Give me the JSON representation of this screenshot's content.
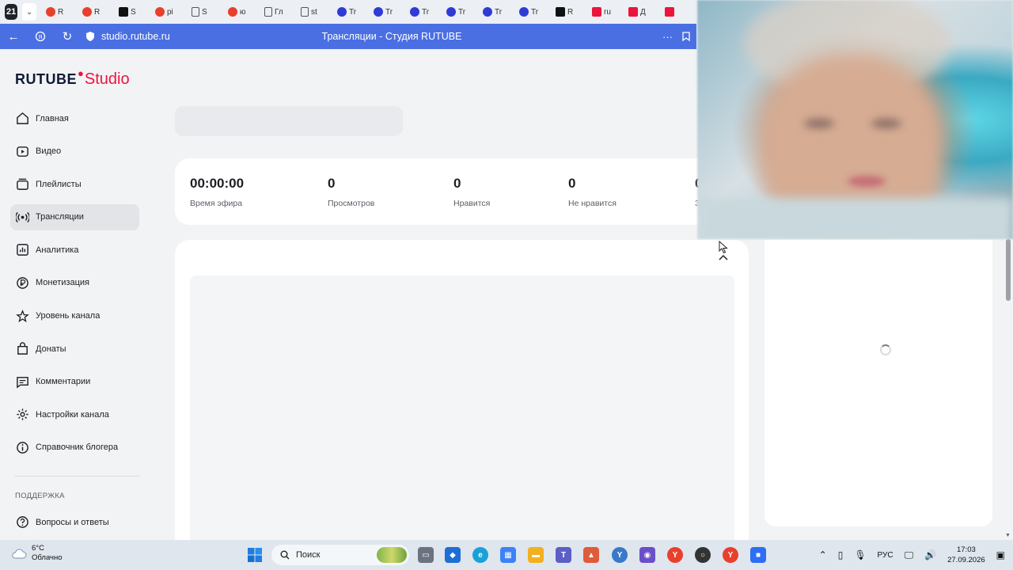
{
  "browser": {
    "tab_counter": "21",
    "tabs": [
      {
        "letter": "R",
        "color": "#e8402c",
        "kind": "yandex"
      },
      {
        "letter": "R",
        "color": "#e8402c",
        "kind": "mail"
      },
      {
        "letter": "S",
        "color": "#111111",
        "kind": "sq"
      },
      {
        "letter": "pi",
        "color": "#e8402c",
        "kind": "yandex"
      },
      {
        "letter": "S",
        "color": "#555555",
        "kind": "doc"
      },
      {
        "letter": "ю",
        "color": "#e8402c",
        "kind": "yandex"
      },
      {
        "letter": "Гл",
        "color": "#555555",
        "kind": "doc"
      },
      {
        "letter": "st",
        "color": "#555555",
        "kind": "doc"
      },
      {
        "letter": "Tr",
        "color": "#2f3bd6",
        "kind": "tw"
      },
      {
        "letter": "Tr",
        "color": "#2f3bd6",
        "kind": "tw"
      },
      {
        "letter": "Tr",
        "color": "#2f3bd6",
        "kind": "tw"
      },
      {
        "letter": "Tr",
        "color": "#2f3bd6",
        "kind": "tw"
      },
      {
        "letter": "Tr",
        "color": "#2f3bd6",
        "kind": "tw"
      },
      {
        "letter": "Tr",
        "color": "#2f3bd6",
        "kind": "tw"
      },
      {
        "letter": "R",
        "color": "#111111",
        "kind": "sq"
      },
      {
        "letter": "ru",
        "color": "#ed143b",
        "kind": "s"
      },
      {
        "letter": "Д",
        "color": "#ed143b",
        "kind": "s"
      },
      {
        "letter": "",
        "color": "#ed143b",
        "kind": "s"
      }
    ],
    "url": "studio.rutube.ru",
    "page_title": "Трансляции - Студия RUTUBE"
  },
  "logo": {
    "brand": "RUTUBE",
    "product": "Studio"
  },
  "sidebar": {
    "items": [
      {
        "label": "Главная",
        "icon": "home-icon",
        "active": false
      },
      {
        "label": "Видео",
        "icon": "video-icon",
        "active": false
      },
      {
        "label": "Плейлисты",
        "icon": "playlist-icon",
        "active": false
      },
      {
        "label": "Трансляции",
        "icon": "broadcast-icon",
        "active": true
      },
      {
        "label": "Аналитика",
        "icon": "analytics-icon",
        "active": false
      },
      {
        "label": "Монетизация",
        "icon": "ruble-icon",
        "active": false
      },
      {
        "label": "Уровень канала",
        "icon": "star-icon",
        "active": false
      },
      {
        "label": "Донаты",
        "icon": "donate-icon",
        "active": false
      },
      {
        "label": "Комментарии",
        "icon": "comments-icon",
        "active": false
      },
      {
        "label": "Настройки канала",
        "icon": "gear-icon",
        "active": false
      },
      {
        "label": "Справочник блогера",
        "icon": "info-icon",
        "active": false
      }
    ],
    "support_label": "ПОДДЕРЖКА",
    "support_items": [
      {
        "label": "Вопросы и ответы",
        "icon": "help-icon"
      }
    ]
  },
  "stats": [
    {
      "value": "00:00:00",
      "label": "Время эфира"
    },
    {
      "value": "0",
      "label": "Просмотров"
    },
    {
      "value": "0",
      "label": "Нравится"
    },
    {
      "value": "0",
      "label": "Не нравится"
    },
    {
      "value": "0",
      "label": "З"
    }
  ],
  "taskbar": {
    "weather_temp": "6°C",
    "weather_desc": "Облачно",
    "search_label": "Поиск",
    "language": "РУС",
    "time": "17:03",
    "date": "27.09.2026"
  },
  "colors": {
    "accent": "#4a6fe3",
    "brand_red": "#ed143b",
    "sidebar_active": "#e2e4e8"
  }
}
